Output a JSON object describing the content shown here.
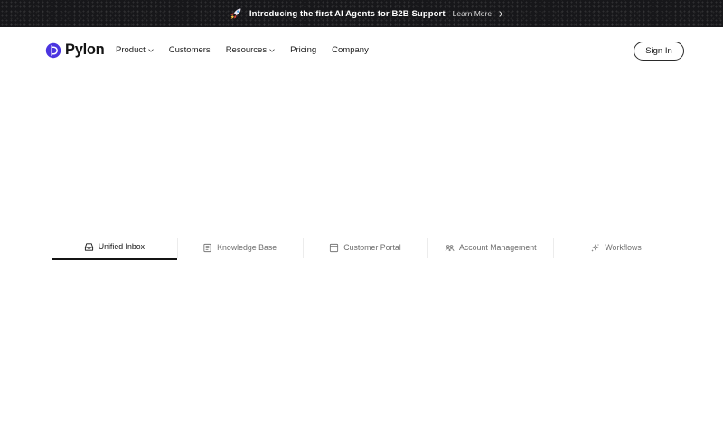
{
  "announcement": {
    "text": "Introducing the first AI Agents for B2B Support",
    "link_label": "Learn More",
    "icons": {
      "rocket": "rocket-icon",
      "arrow": "arrow-right-icon"
    }
  },
  "nav": {
    "brand": "Pylon",
    "items": [
      {
        "label": "Product",
        "has_dropdown": true
      },
      {
        "label": "Customers",
        "has_dropdown": false
      },
      {
        "label": "Resources",
        "has_dropdown": true
      },
      {
        "label": "Pricing",
        "has_dropdown": false
      },
      {
        "label": "Company",
        "has_dropdown": false
      }
    ],
    "signin_label": "Sign In"
  },
  "tabs": {
    "active_index": 0,
    "items": [
      {
        "label": "Unified Inbox",
        "icon": "inbox-icon"
      },
      {
        "label": "Knowledge Base",
        "icon": "book-icon"
      },
      {
        "label": "Customer Portal",
        "icon": "browser-window-icon"
      },
      {
        "label": "Account Management",
        "icon": "users-icon"
      },
      {
        "label": "Workflows",
        "icon": "sparkle-icon"
      }
    ]
  },
  "colors": {
    "announcement_bg": "#17171a",
    "text": "#141414",
    "muted": "#6e6e6e",
    "brand": "#4b35e0"
  }
}
